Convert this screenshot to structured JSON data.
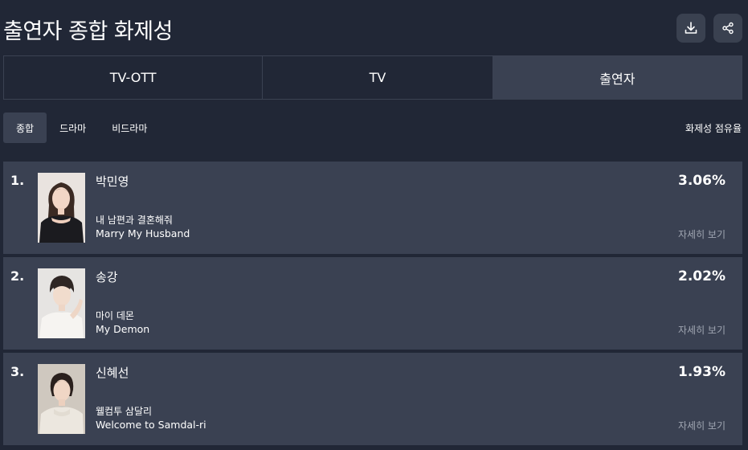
{
  "header": {
    "title": "출연자 종합 화제성",
    "download_icon": "download-icon",
    "share_icon": "share-icon"
  },
  "tabs": [
    {
      "label": "TV-OTT",
      "active": false
    },
    {
      "label": "TV",
      "active": false
    },
    {
      "label": "출연자",
      "active": true
    }
  ],
  "subtabs": [
    {
      "label": "종합",
      "active": true
    },
    {
      "label": "드라마",
      "active": false
    },
    {
      "label": "비드라마",
      "active": false
    }
  ],
  "share_label": "화제성 점유율",
  "detail_label": "자세히 보기",
  "ranking": [
    {
      "rank": "1.",
      "name": "박민영",
      "title_ko": "내 남편과 결혼해줘",
      "title_en": "Marry My Husband",
      "share": "3.06%"
    },
    {
      "rank": "2.",
      "name": "송강",
      "title_ko": "마이 데몬",
      "title_en": "My Demon",
      "share": "2.02%"
    },
    {
      "rank": "3.",
      "name": "신혜선",
      "title_ko": "웰컴투 삼달리",
      "title_en": "Welcome to Samdal-ri",
      "share": "1.93%"
    }
  ],
  "colors": {
    "background": "#212736",
    "card": "#3a4152",
    "muted_text": "#a0a6b2"
  }
}
